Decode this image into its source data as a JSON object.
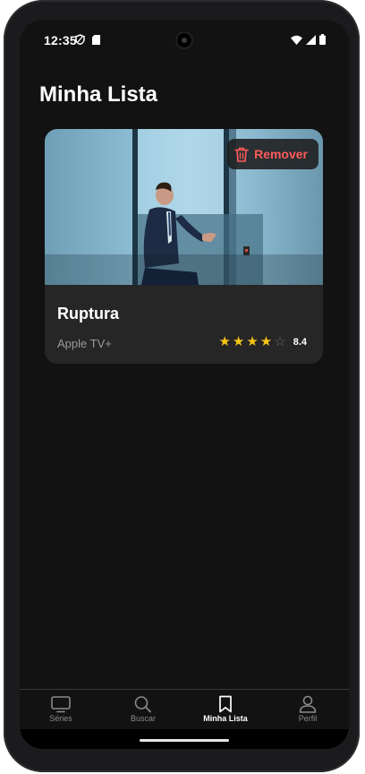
{
  "status": {
    "time": "12:35"
  },
  "page": {
    "title": "Minha Lista"
  },
  "card": {
    "title": "Ruptura",
    "network": "Apple TV+",
    "remove_label": "Remover",
    "rating_value": "8.4",
    "stars_filled": 4,
    "stars_total": 5,
    "icon": "trash-icon"
  },
  "nav": {
    "items": [
      {
        "label": "Séries",
        "icon": "tv-icon"
      },
      {
        "label": "Buscar",
        "icon": "search-icon"
      },
      {
        "label": "Minha Lista",
        "icon": "bookmark-icon",
        "active": true
      },
      {
        "label": "Perfil",
        "icon": "person-icon"
      }
    ]
  },
  "colors": {
    "background": "#121212",
    "card": "#262626",
    "remove": "#ff5a5a",
    "star": "#f5c518"
  }
}
